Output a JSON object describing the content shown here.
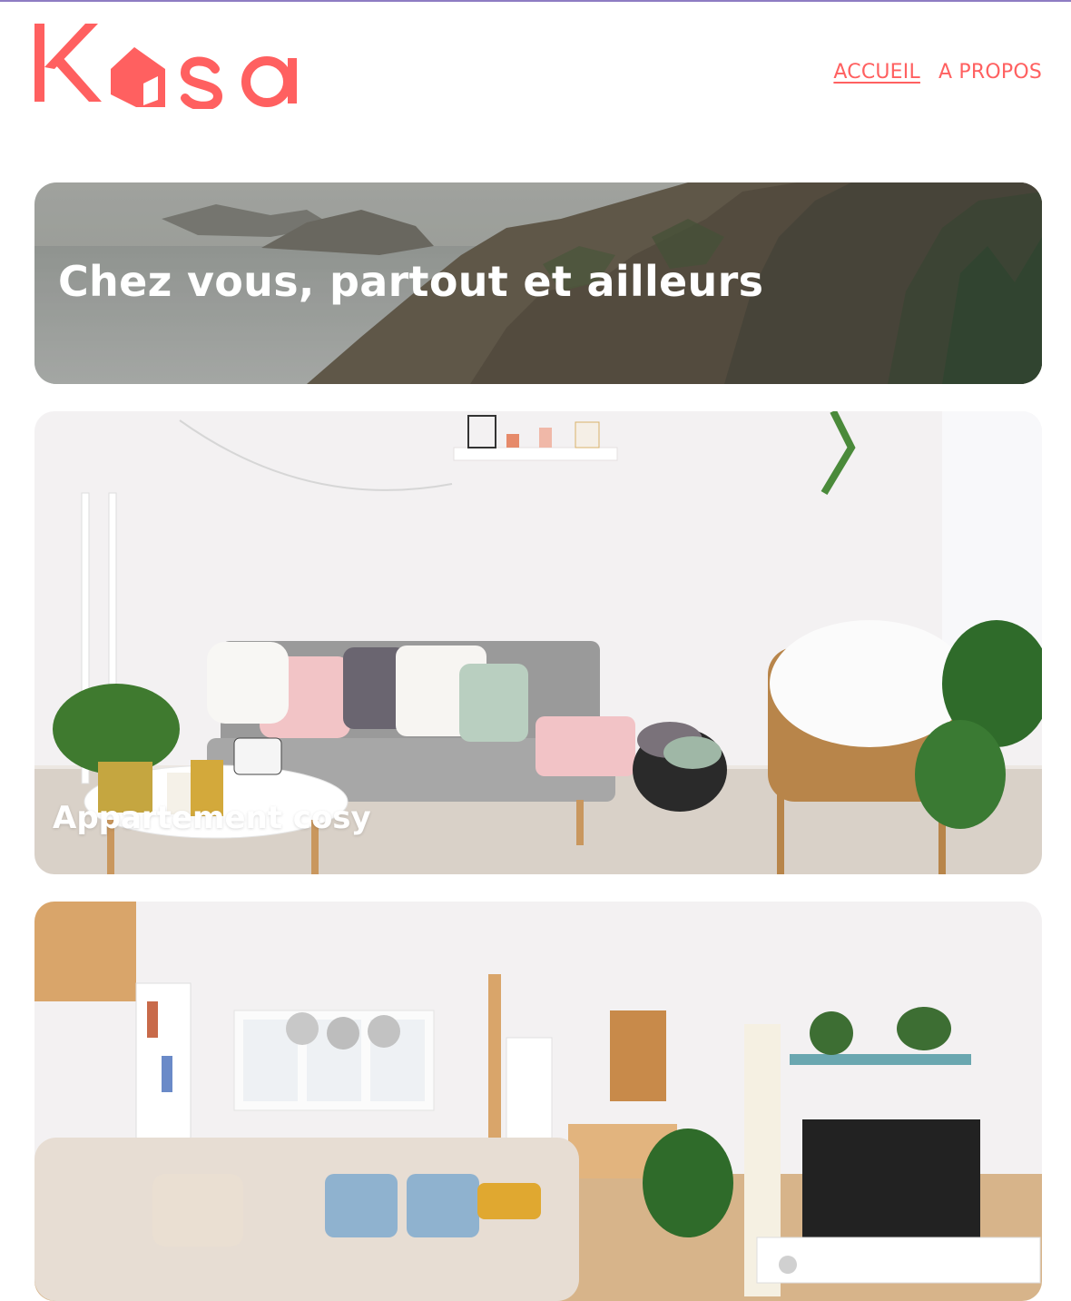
{
  "brand": {
    "name": "Kasa",
    "accent_color": "#ff6060"
  },
  "nav": {
    "items": [
      {
        "label": "ACCUEIL",
        "active": true
      },
      {
        "label": "A PROPOS",
        "active": false
      }
    ]
  },
  "banner": {
    "title": "Chez vous, partout et ailleurs",
    "image": "coastal-cliffs-photo"
  },
  "listings": [
    {
      "title": "Appartement cosy",
      "image": "cosy-living-room-photo"
    },
    {
      "title": "",
      "image": "bright-living-room-photo"
    }
  ]
}
